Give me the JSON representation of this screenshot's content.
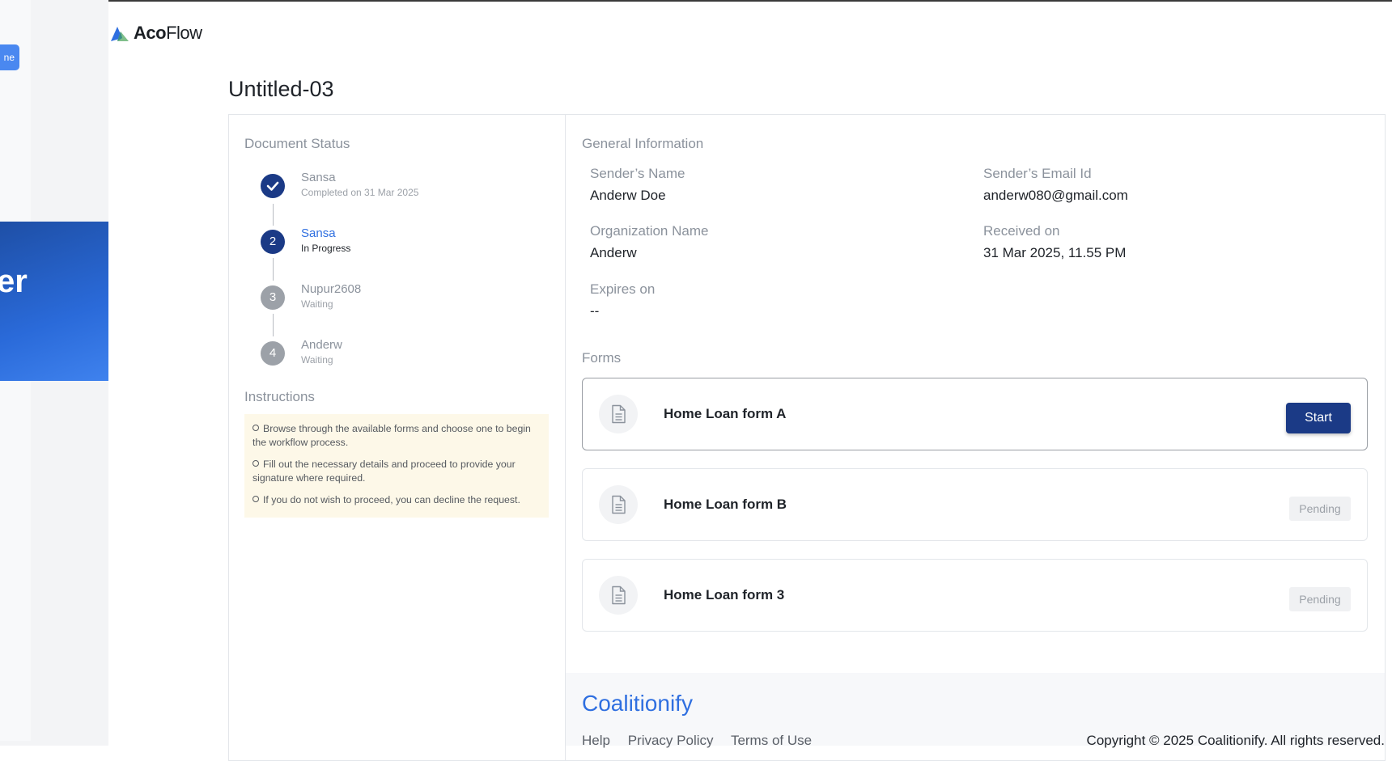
{
  "background": {
    "button_label": "ne",
    "banner_text": "er"
  },
  "logo": {
    "brand_bold": "Aco",
    "brand_thin": "Flow"
  },
  "page": {
    "title": "Untitled-03"
  },
  "document_status": {
    "title": "Document Status",
    "steps": [
      {
        "number": "",
        "name": "Sansa",
        "status": "Completed on 31 Mar 2025",
        "state": "done"
      },
      {
        "number": "2",
        "name": "Sansa",
        "status": "In Progress",
        "state": "active"
      },
      {
        "number": "3",
        "name": "Nupur2608",
        "status": "Waiting",
        "state": "waiting"
      },
      {
        "number": "4",
        "name": "Anderw",
        "status": "Waiting",
        "state": "waiting"
      }
    ]
  },
  "instructions": {
    "title": "Instructions",
    "items": [
      "Browse through the available forms and choose one to begin the workflow process.",
      "Fill out the necessary details and proceed to provide your signature where required.",
      "If you do not wish to proceed, you can decline the request."
    ]
  },
  "general_info": {
    "title": "General Information",
    "sender_name_label": "Sender’s Name",
    "sender_name": "Anderw Doe",
    "sender_email_label": "Sender’s Email Id",
    "sender_email": "anderw080@gmail.com",
    "org_label": "Organization Name",
    "org": "Anderw",
    "received_label": "Received on",
    "received": "31 Mar 2025, 11.55 PM",
    "expires_label": "Expires on",
    "expires": "--"
  },
  "forms": {
    "title": "Forms",
    "items": [
      {
        "name": "Home Loan form A",
        "action": "Start"
      },
      {
        "name": "Home Loan form B",
        "action": "Pending"
      },
      {
        "name": "Home Loan form 3",
        "action": "Pending"
      }
    ]
  },
  "footer": {
    "brand": "Coalitionify",
    "links": [
      "Help",
      "Privacy Policy",
      "Terms of Use"
    ],
    "copyright": "Copyright © 2025 Coalitionify. All rights reserved."
  },
  "colors": {
    "primary": "#1b3a86",
    "accent_blue": "#2f6fe0",
    "instructions_bg": "#fdf8e8",
    "logo_blue": "#2f6fe0",
    "logo_green": "#7fbf8a"
  }
}
